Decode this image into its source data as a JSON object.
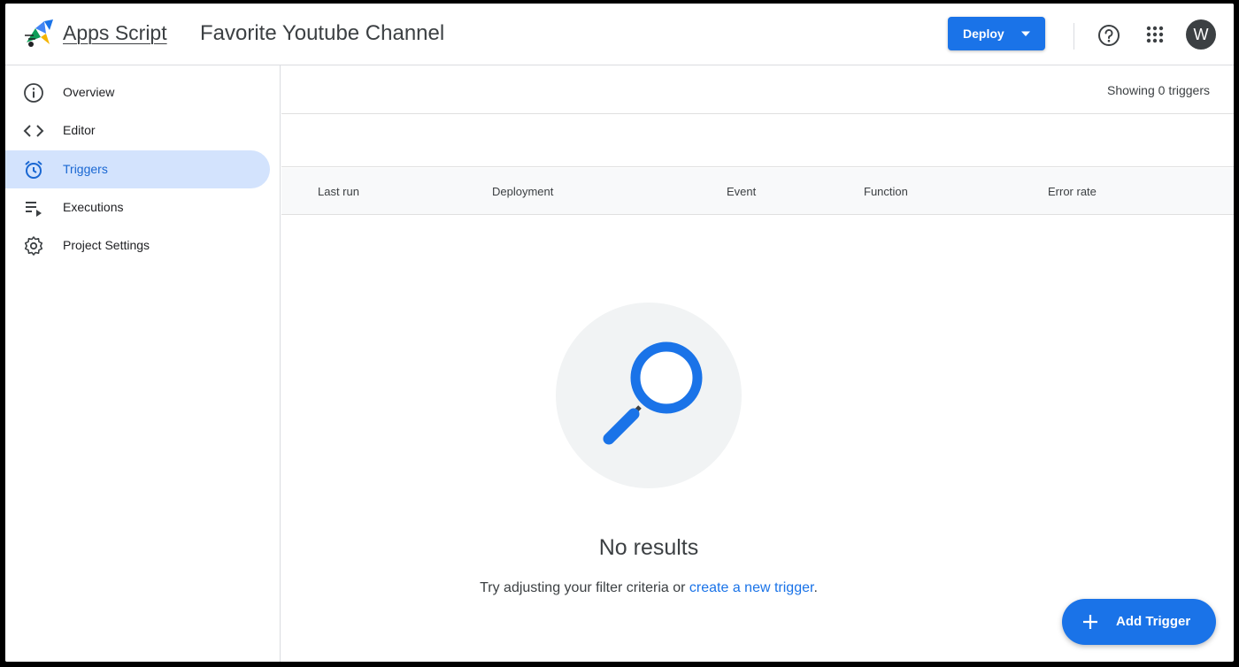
{
  "app": {
    "brand": "Apps Script",
    "project_title": "Favorite Youtube Channel",
    "logo_icon": "apps-script-logo-icon"
  },
  "header": {
    "deploy_label": "Deploy",
    "help_icon": "help-circle-icon",
    "apps_icon": "apps-grid-icon",
    "avatar_initial": "W"
  },
  "sidebar": {
    "items": [
      {
        "label": "Overview",
        "icon": "info-icon",
        "active": false
      },
      {
        "label": "Editor",
        "icon": "code-icon",
        "active": false
      },
      {
        "label": "Triggers",
        "icon": "alarm-clock-icon",
        "active": true
      },
      {
        "label": "Executions",
        "icon": "playlist-play-icon",
        "active": false
      },
      {
        "label": "Project Settings",
        "icon": "gear-icon",
        "active": false
      }
    ]
  },
  "main": {
    "status_text": "Showing 0 triggers",
    "columns": [
      "Last run",
      "Deployment",
      "Event",
      "Function",
      "Error rate"
    ],
    "empty": {
      "title": "No results",
      "text": "Try adjusting your filter criteria or ",
      "link": "create a new trigger",
      "suffix": ".",
      "icon": "search-magnifier-icon"
    },
    "fab_label": "Add Trigger"
  },
  "colors": {
    "accent": "#1a73e8",
    "active_nav_bg": "#d3e3fd",
    "active_nav_text": "#1967d2"
  }
}
